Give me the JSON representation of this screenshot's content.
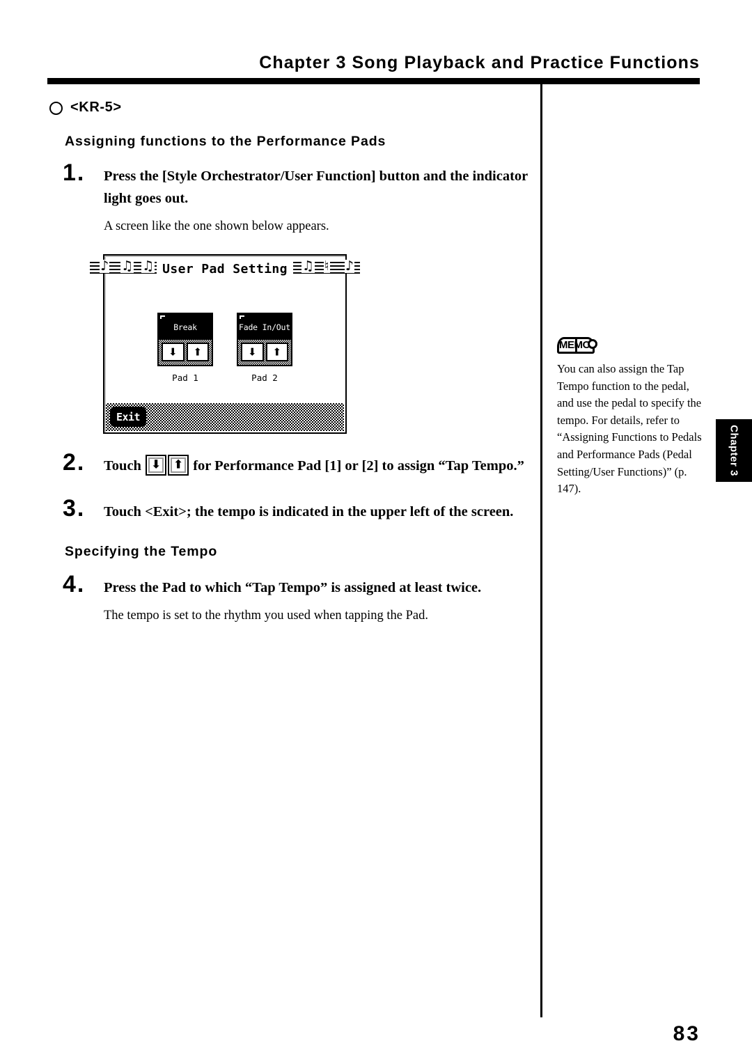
{
  "header": {
    "title": "Chapter 3 Song Playback and Practice Functions"
  },
  "model_tag": {
    "bullet_icon": "circle-outline-icon",
    "label": "<KR-5>"
  },
  "sections": [
    {
      "heading": "Assigning functions to the Performance Pads"
    },
    {
      "heading": "Specifying the Tempo"
    }
  ],
  "steps": [
    {
      "number": "1.",
      "text": "Press the [Style Orchestrator/User Function] button and the indicator light goes out.",
      "sub": "A screen like the one shown below appears."
    },
    {
      "number": "2.",
      "text_before": "Touch",
      "text_after": "for Performance Pad [1] or [2] to assign “Tap Tempo.”",
      "down_icon": "arrow-down-icon",
      "up_icon": "arrow-up-icon"
    },
    {
      "number": "3.",
      "text": "Touch <Exit>; the tempo is indicated in the upper left of the screen."
    },
    {
      "number": "4.",
      "text": "Press the Pad to which “Tap Tempo” is assigned at least twice.",
      "sub": "The tempo is set to the rhythm you used when tapping the Pad."
    }
  ],
  "lcd": {
    "title": "User Pad Setting",
    "left_notes": [
      "♪",
      "♫",
      "♫"
    ],
    "right_notes": [
      "♫",
      "♮",
      "♪"
    ],
    "pads": [
      {
        "label": "Break",
        "caption": "Pad 1",
        "down_icon": "arrow-down-icon",
        "up_icon": "arrow-up-icon",
        "down_glyph": "⬇",
        "up_glyph": "⬆"
      },
      {
        "label": "Fade In/Out",
        "caption": "Pad 2",
        "down_icon": "arrow-down-icon",
        "up_icon": "arrow-up-icon",
        "down_glyph": "⬇",
        "up_glyph": "⬆"
      }
    ],
    "exit_button": "Exit"
  },
  "memo": {
    "icon_name": "memo-book-icon",
    "icon_label": "MEMO",
    "body": "You can also assign the Tap Tempo function to the pedal, and use the pedal to specify the tempo. For details, refer to “Assigning Functions to Pedals and Performance Pads (Pedal Setting/User Functions)” (p. 147)."
  },
  "chapter_tab": {
    "label": "Chapter 3"
  },
  "page_number": "83",
  "glyphs": {
    "arrow_down": "⬇",
    "arrow_up": "⬆"
  }
}
